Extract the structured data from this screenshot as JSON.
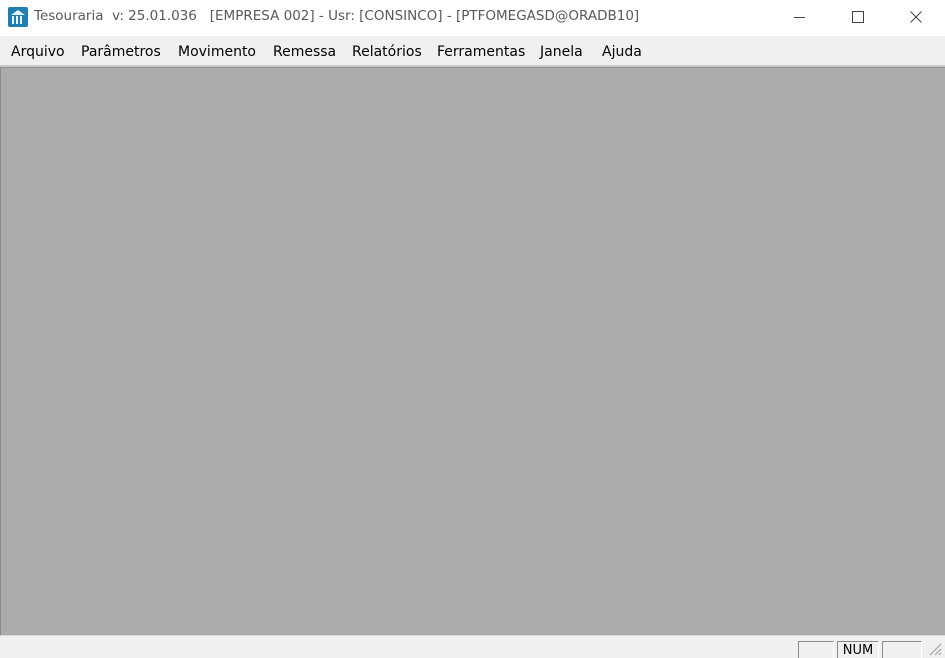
{
  "window": {
    "title": "Tesouraria  v: 25.01.036   [EMPRESA 002] - Usr: [CONSINCO] - [PTFOMEGASD@ORADB10]",
    "app_icon": "bank-icon"
  },
  "caption_buttons": {
    "minimize_icon": "minimize-icon",
    "maximize_icon": "maximize-icon",
    "close_icon": "close-icon"
  },
  "menu": {
    "items": [
      {
        "label": "Arquivo"
      },
      {
        "label": "Parâmetros"
      },
      {
        "label": "Movimento"
      },
      {
        "label": "Remessa"
      },
      {
        "label": "Relatórios"
      },
      {
        "label": "Ferramentas"
      },
      {
        "label": "Janela"
      },
      {
        "label": "Ajuda"
      }
    ]
  },
  "statusbar": {
    "panels": [
      "",
      "NUM",
      ""
    ]
  },
  "colors": {
    "mdi_background": "#ababab",
    "chrome": "#f0f0f0",
    "title_text": "#595959",
    "icon_blue": "#1f7fb3"
  }
}
